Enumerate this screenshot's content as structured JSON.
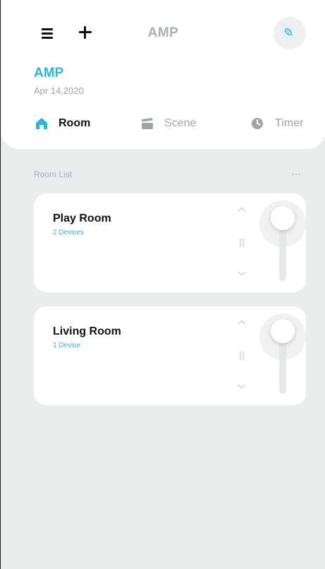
{
  "header": {
    "title": "AMP",
    "home_name": "AMP",
    "date": "Apr 14,2020"
  },
  "tabs": [
    {
      "label": "Room",
      "icon": "home-icon",
      "active": true
    },
    {
      "label": "Scene",
      "icon": "scene-icon",
      "active": false
    },
    {
      "label": "Timer",
      "icon": "clock-icon",
      "active": false
    }
  ],
  "room_list": {
    "title": "Room List",
    "more_label": "···",
    "rooms": [
      {
        "name": "Play Room",
        "devices": "2 Devices",
        "slider_level": 1.0
      },
      {
        "name": "Living Room",
        "devices": "1 Device",
        "slider_level": 1.0
      }
    ]
  },
  "colors": {
    "accent": "#29b6de",
    "background": "#e9eded",
    "card": "#ffffff",
    "muted": "#9ea5a7"
  }
}
